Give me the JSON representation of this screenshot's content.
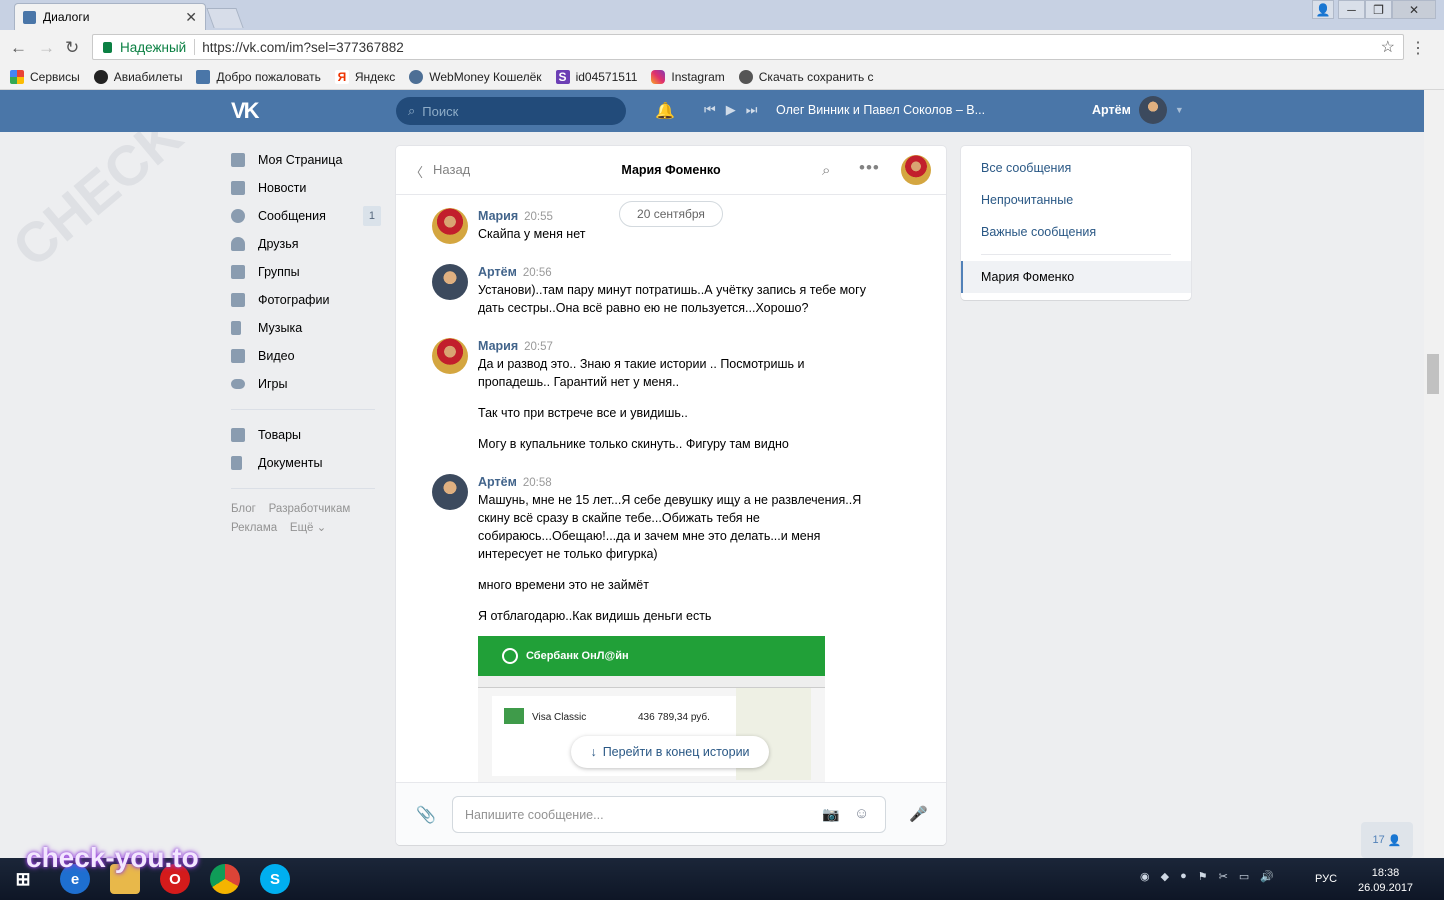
{
  "browser": {
    "tab_title": "Диалоги",
    "secure_label": "Надежный",
    "url": "https://vk.com/im?sel=377367882",
    "bookmarks": [
      "Сервисы",
      "Авиабилеты",
      "Добро пожаловать",
      "Яндекс",
      "WebMoney Кошелёк",
      "id04571511",
      "Instagram",
      "Скачать сохранить с"
    ]
  },
  "vk_header": {
    "logo": "VK",
    "search_placeholder": "Поиск",
    "track": "Олег Винник и Павел Соколов – В...",
    "user_name": "Артём"
  },
  "left_nav": {
    "items": [
      {
        "label": "Моя Страница"
      },
      {
        "label": "Новости"
      },
      {
        "label": "Сообщения",
        "count": "1"
      },
      {
        "label": "Друзья"
      },
      {
        "label": "Группы"
      },
      {
        "label": "Фотографии"
      },
      {
        "label": "Музыка"
      },
      {
        "label": "Видео"
      },
      {
        "label": "Игры"
      }
    ],
    "items2": [
      {
        "label": "Товары"
      },
      {
        "label": "Документы"
      }
    ],
    "footer": [
      "Блог",
      "Разработчикам",
      "Реклама",
      "Ещё"
    ]
  },
  "chat": {
    "back_label": "Назад",
    "title": "Мария Фоменко",
    "date_pill": "20 сентября",
    "messages": [
      {
        "name": "Мария",
        "time": "20:55",
        "texts": [
          "Скайпа у меня нет"
        ]
      },
      {
        "name": "Артём",
        "time": "20:56",
        "texts": [
          "Установи)..там пару минут потратишь..А учётку запись я тебе могу дать сестры..Она всё равно ею не пользуется...Хорошо?"
        ]
      },
      {
        "name": "Мария",
        "time": "20:57",
        "texts": [
          "Да и развод это.. Знаю я такие истории .. Посмотришь и пропадешь.. Гарантий нет у меня..",
          "Так что при встрече все и увидишь..",
          "Могу в купальнике только скинуть.. Фигуру там видно"
        ]
      },
      {
        "name": "Артём",
        "time": "20:58",
        "texts": [
          "Машунь, мне не 15 лет...Я себе девушку ищу а не развлечения..Я скину всё сразу в скайпе тебе...Обижать тебя не собираюсь...Обещаю!...да и зачем мне это делать...и меня интересует не только фигурка)",
          "много времени это не займёт",
          "Я отблагодарю..Как видишь деньги есть"
        ]
      }
    ],
    "attachment": {
      "bank": "Сбербанк ОнЛ@йн",
      "card": "Visa Classic",
      "balance": "436 789,34 руб."
    },
    "goto_end": "Перейти в конец истории",
    "composer_placeholder": "Напишите сообщение..."
  },
  "right_filter": {
    "items": [
      "Все сообщения",
      "Непрочитанные",
      "Важные сообщения"
    ],
    "active": "Мария Фоменко"
  },
  "online_count": "17",
  "taskbar": {
    "lang": "РУС",
    "time": "18:38",
    "date": "26.09.2017"
  },
  "watermark": "check-you.to",
  "colors": {
    "vk_blue": "#4a76a8",
    "link": "#2a5885",
    "name": "#42648b",
    "bg": "#edeef0"
  }
}
